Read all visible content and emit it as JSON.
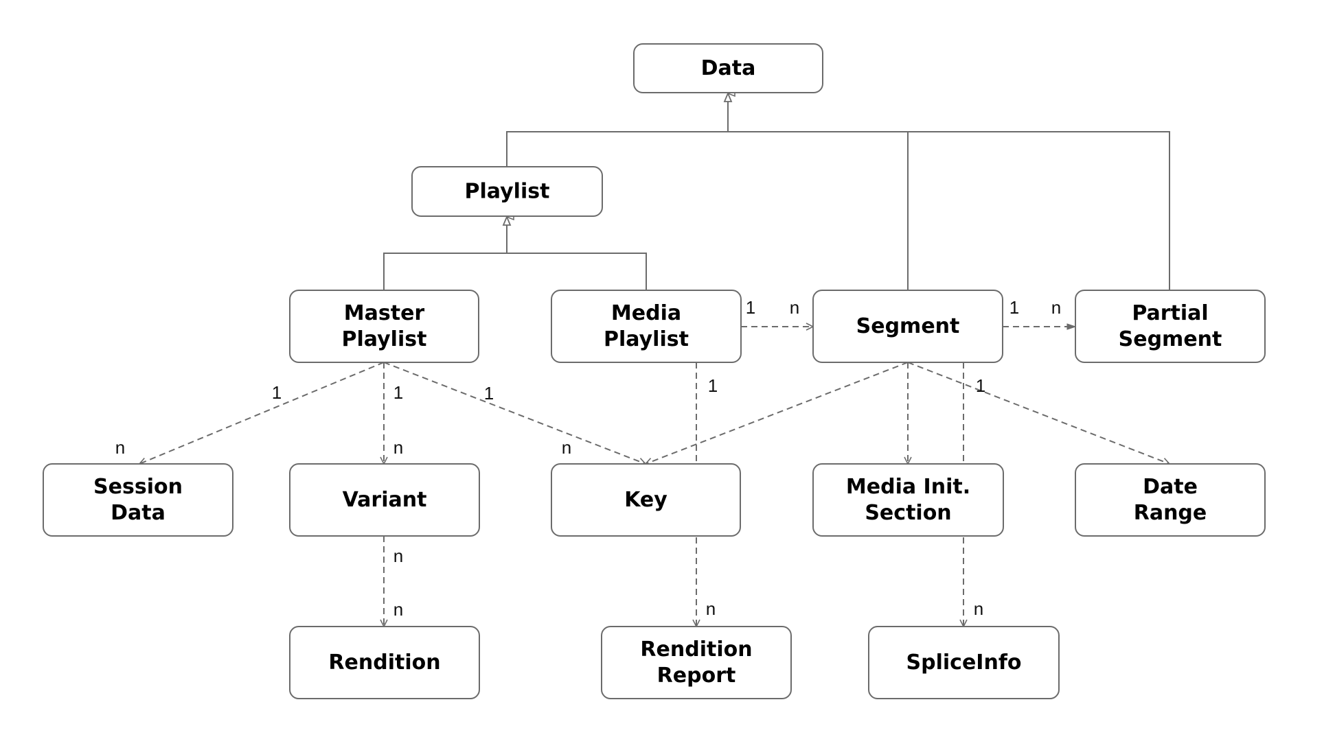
{
  "diagram": {
    "type": "class-hierarchy",
    "colors": {
      "stroke": "#6b6b6b",
      "text": "#000000",
      "background": "#ffffff"
    },
    "nodes": [
      {
        "id": "data",
        "label": [
          "Data"
        ]
      },
      {
        "id": "playlist",
        "label": [
          "Playlist"
        ]
      },
      {
        "id": "master",
        "label": [
          "Master",
          "Playlist"
        ]
      },
      {
        "id": "media",
        "label": [
          "Media",
          "Playlist"
        ]
      },
      {
        "id": "segment",
        "label": [
          "Segment"
        ]
      },
      {
        "id": "partial",
        "label": [
          "Partial",
          "Segment"
        ]
      },
      {
        "id": "session",
        "label": [
          "Session",
          "Data"
        ]
      },
      {
        "id": "variant",
        "label": [
          "Variant"
        ]
      },
      {
        "id": "key",
        "label": [
          "Key"
        ]
      },
      {
        "id": "mediainit",
        "label": [
          "Media Init.",
          "Section"
        ]
      },
      {
        "id": "daterange",
        "label": [
          "Date",
          "Range"
        ]
      },
      {
        "id": "rendition",
        "label": [
          "Rendition"
        ]
      },
      {
        "id": "renditionreport",
        "label": [
          "Rendition",
          "Report"
        ]
      },
      {
        "id": "spliceinfo",
        "label": [
          "SpliceInfo"
        ]
      }
    ],
    "inheritance": [
      {
        "child": "playlist",
        "parent": "data"
      },
      {
        "child": "segment",
        "parent": "data"
      },
      {
        "child": "partial",
        "parent": "data"
      },
      {
        "child": "master",
        "parent": "playlist"
      },
      {
        "child": "media",
        "parent": "playlist"
      }
    ],
    "associations": [
      {
        "from": "master",
        "to": "session",
        "from_mult": "1",
        "to_mult": "n"
      },
      {
        "from": "master",
        "to": "variant",
        "from_mult": "1",
        "to_mult": "n"
      },
      {
        "from": "master",
        "to": "key",
        "from_mult": "1",
        "to_mult": "n"
      },
      {
        "from": "media",
        "to": "segment",
        "from_mult": "1",
        "to_mult": "n"
      },
      {
        "from": "segment",
        "to": "partial",
        "from_mult": "1",
        "to_mult": "n"
      },
      {
        "from": "media",
        "to": "renditionreport",
        "from_mult": "1",
        "to_mult": "n"
      },
      {
        "from": "segment",
        "to": "key",
        "from_mult": "",
        "to_mult": ""
      },
      {
        "from": "segment",
        "to": "mediainit",
        "from_mult": "",
        "to_mult": ""
      },
      {
        "from": "segment",
        "to": "daterange",
        "from_mult": "1",
        "to_mult": ""
      },
      {
        "from": "segment",
        "to": "spliceinfo",
        "from_mult": "",
        "to_mult": "n"
      },
      {
        "from": "variant",
        "to": "rendition",
        "from_mult": "n",
        "to_mult": "n"
      }
    ]
  }
}
